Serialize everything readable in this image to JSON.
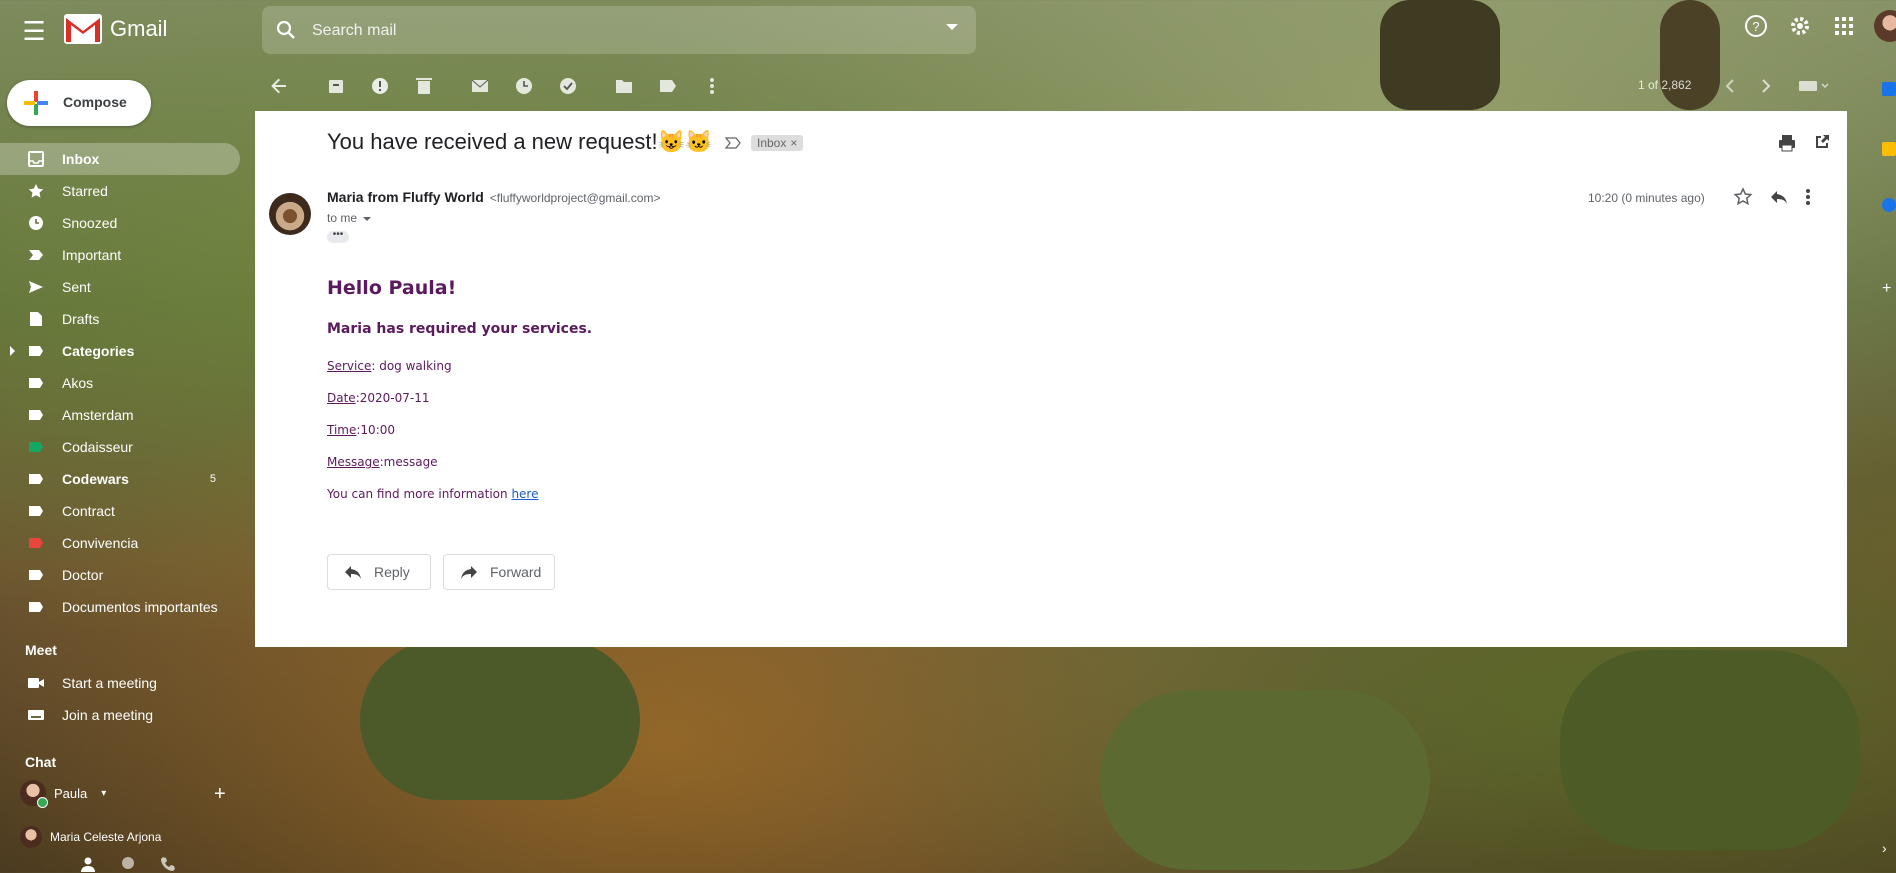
{
  "app": {
    "name": "Gmail"
  },
  "search": {
    "placeholder": "Search mail"
  },
  "compose": {
    "label": "Compose"
  },
  "sidebar": {
    "items": [
      {
        "label": "Inbox",
        "icon": "inbox-icon",
        "active": true,
        "bold": true
      },
      {
        "label": "Starred",
        "icon": "star-icon"
      },
      {
        "label": "Snoozed",
        "icon": "clock-icon"
      },
      {
        "label": "Important",
        "icon": "important-icon"
      },
      {
        "label": "Sent",
        "icon": "send-icon"
      },
      {
        "label": "Drafts",
        "icon": "draft-icon"
      },
      {
        "label": "Categories",
        "icon": "label-icon",
        "bold": true,
        "expandable": true
      },
      {
        "label": "Akos",
        "icon": "label-icon"
      },
      {
        "label": "Amsterdam",
        "icon": "label-icon"
      },
      {
        "label": "Codaisseur",
        "icon": "label-icon",
        "color": "#16a765"
      },
      {
        "label": "Codewars",
        "icon": "label-icon",
        "bold": true,
        "count": "5"
      },
      {
        "label": "Contract",
        "icon": "label-icon"
      },
      {
        "label": "Convivencia",
        "icon": "label-icon",
        "color": "#e8453c"
      },
      {
        "label": "Doctor",
        "icon": "label-icon"
      },
      {
        "label": "Documentos importantes",
        "icon": "label-icon"
      }
    ]
  },
  "meet": {
    "title": "Meet",
    "start": "Start a meeting",
    "join": "Join a meeting"
  },
  "chat": {
    "title": "Chat",
    "users": [
      "Paula",
      "Maria Celeste Arjona"
    ]
  },
  "toolbar": {
    "pager": "1 of 2,862"
  },
  "email": {
    "subject": "You have received a new request!",
    "subject_emoji": "😺🐱",
    "label_chip": "Inbox",
    "sender_name": "Maria from Fluffy World",
    "sender_email": "<fluffyworldproject@gmail.com>",
    "to": "to me",
    "time": "10:20 (0 minutes ago)",
    "body": {
      "greeting": "Hello Paula!",
      "intro": "Maria has required your services.",
      "service_key": "Service",
      "service_val": ": dog walking",
      "date_key": "Date",
      "date_val": ":2020-07-11",
      "time_key": "Time",
      "time_val": ":10:00",
      "message_key": "Message",
      "message_val": ":message",
      "more_info": "You can find more information ",
      "link": "here"
    },
    "reply_label": "Reply",
    "forward_label": "Forward"
  },
  "colors": {
    "body_text": "#5b1a5e",
    "link": "#1a5cc8",
    "active_nav_bg": "rgba(255,255,255,0.28)"
  }
}
